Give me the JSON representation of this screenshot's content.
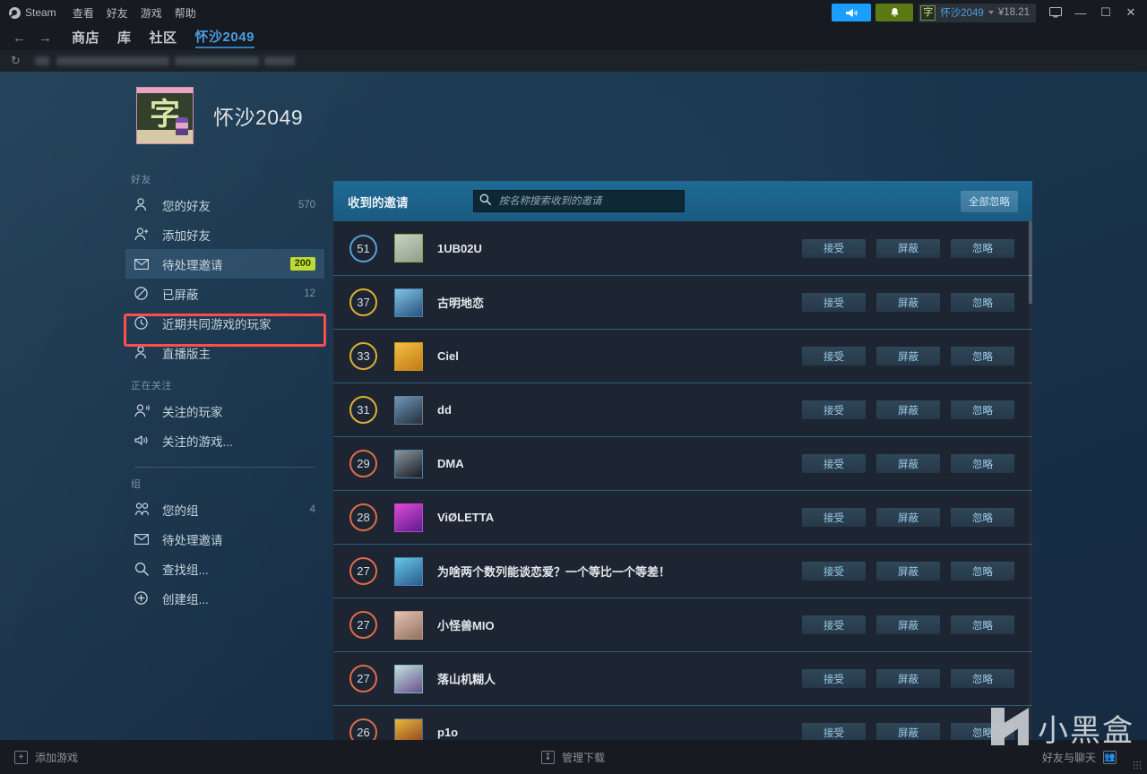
{
  "titlebar": {
    "app": "Steam",
    "menus": [
      "查看",
      "好友",
      "游戏",
      "帮助"
    ],
    "broadcast_icon": "megaphone-icon",
    "notifications_icon": "bell-icon",
    "account": {
      "avatar_glyph": "字",
      "name": "怀沙2049",
      "balance": "¥18.21"
    },
    "window_controls": {
      "display": "⌧",
      "minimize": "—",
      "maximize": "☐",
      "close": "✕"
    }
  },
  "nav": {
    "back": "←",
    "forward": "→",
    "tabs": [
      {
        "label": "商店",
        "active": false
      },
      {
        "label": "库",
        "active": false
      },
      {
        "label": "社区",
        "active": false
      },
      {
        "label": "怀沙2049",
        "active": true
      }
    ]
  },
  "urlbar": {
    "refresh_icon": "refresh-icon"
  },
  "profile": {
    "avatar_glyph": "字",
    "title": "怀沙2049"
  },
  "sidebar": {
    "groups": [
      {
        "label": "好友",
        "items": [
          {
            "icon": "person-icon",
            "label": "您的好友",
            "count": "570",
            "badge": false,
            "selected": false
          },
          {
            "icon": "person-add-icon",
            "label": "添加好友",
            "count": "",
            "badge": false,
            "selected": false
          },
          {
            "icon": "envelope-icon",
            "label": "待处理邀请",
            "count": "200",
            "badge": true,
            "selected": true
          },
          {
            "icon": "block-icon",
            "label": "已屏蔽",
            "count": "12",
            "badge": false,
            "selected": false
          },
          {
            "icon": "clock-icon",
            "label": "近期共同游戏的玩家",
            "count": "",
            "badge": false,
            "selected": false
          },
          {
            "icon": "person-icon",
            "label": "直播版主",
            "count": "",
            "badge": false,
            "selected": false
          }
        ]
      },
      {
        "label": "正在关注",
        "items": [
          {
            "icon": "person-follow-icon",
            "label": "关注的玩家",
            "count": "",
            "badge": false,
            "selected": false
          },
          {
            "icon": "speaker-icon",
            "label": "关注的游戏...",
            "count": "",
            "badge": false,
            "selected": false
          }
        ]
      },
      {
        "label": "组",
        "items": [
          {
            "icon": "group-icon",
            "label": "您的组",
            "count": "4",
            "badge": false,
            "selected": false
          },
          {
            "icon": "envelope-icon",
            "label": "待处理邀请",
            "count": "",
            "badge": false,
            "selected": false
          },
          {
            "icon": "search-icon",
            "label": "查找组...",
            "count": "",
            "badge": false,
            "selected": false
          },
          {
            "icon": "plus-icon",
            "label": "创建组...",
            "count": "",
            "badge": false,
            "selected": false
          }
        ]
      }
    ],
    "highlight_color": "#ff4d4d",
    "badge_color": "#bddb31"
  },
  "panel": {
    "title": "收到的邀请",
    "search_placeholder": "按名称搜索收到的邀请",
    "search_value": "",
    "search_icon": "search-icon",
    "ignore_all_label": "全部忽略"
  },
  "actions": {
    "accept": "接受",
    "block": "屏蔽",
    "ignore": "忽略"
  },
  "invites": [
    {
      "level": "51",
      "ring": "#55a0d0",
      "name": "1UB02U",
      "avatar_border": "#7eab4a",
      "avatar_a": "#c9d3c4",
      "avatar_b": "#8e9f8a"
    },
    {
      "level": "37",
      "ring": "#d8b132",
      "name": "古明地恋",
      "avatar_border": "#4a7fa8",
      "avatar_a": "#7fc4e8",
      "avatar_b": "#29527a"
    },
    {
      "level": "33",
      "ring": "#d8b132",
      "name": "Ciel",
      "avatar_border": "#c9931f",
      "avatar_a": "#f0c043",
      "avatar_b": "#c47a16"
    },
    {
      "level": "31",
      "ring": "#d8b132",
      "name": "dd",
      "avatar_border": "#6e7b86",
      "avatar_a": "#6d97bd",
      "avatar_b": "#24303c"
    },
    {
      "level": "29",
      "ring": "#e06a4a",
      "name": "DMA",
      "avatar_border": "#3f89a6",
      "avatar_a": "#8d97a0",
      "avatar_b": "#161c22"
    },
    {
      "level": "28",
      "ring": "#e06a4a",
      "name": "ViØLETTA",
      "avatar_border": "#c43fd0",
      "avatar_a": "#e049d8",
      "avatar_b": "#5b1d8a"
    },
    {
      "level": "27",
      "ring": "#e06a4a",
      "name": "为啥两个数列能谈恋爱？一个等比一个等差！",
      "avatar_border": "#4d7fb0",
      "avatar_a": "#66c8e8",
      "avatar_b": "#2a5b8c"
    },
    {
      "level": "27",
      "ring": "#e06a4a",
      "name": "小怪兽MIO",
      "avatar_border": "#b39a8c",
      "avatar_a": "#e3c3b4",
      "avatar_b": "#96705f"
    },
    {
      "level": "27",
      "ring": "#e06a4a",
      "name": "落山机糊人",
      "avatar_border": "#7fb7b5",
      "avatar_a": "#bfe3de",
      "avatar_b": "#6a4f8e"
    },
    {
      "level": "26",
      "ring": "#e06a4a",
      "name": "p1o",
      "avatar_border": "#4f6d8c",
      "avatar_a": "#e8b93a",
      "avatar_b": "#8a3a1e"
    }
  ],
  "bottombar": {
    "add_game": "添加游戏",
    "manage_downloads": "管理下载",
    "friends_chat": "好友与聊天",
    "add_icon": "plus-square-icon",
    "download_icon": "download-icon",
    "friends_icon": "friends-square-icon"
  },
  "watermark": {
    "text": "小黑盒"
  }
}
